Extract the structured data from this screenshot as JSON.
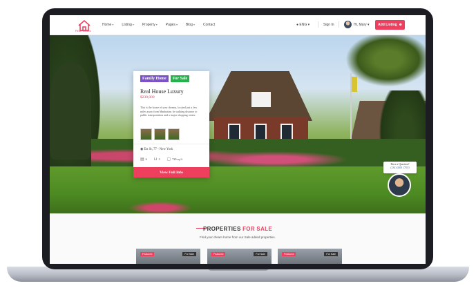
{
  "logo": {
    "text": "Find Houses"
  },
  "nav": {
    "items": [
      "Home",
      "Listing",
      "Property",
      "Pages",
      "Blog",
      "Contact"
    ],
    "language": "ENG",
    "signin": "Sign In",
    "user": "Hi, Mary",
    "add_listing": "Add Listing"
  },
  "card": {
    "badge_type": "Family Home",
    "badge_status": "For Sale",
    "title": "Real House Luxury",
    "price": "$230,000",
    "description": "This is the house of your dreams, located just a few miles away from Manhattan. In walking distance to public transportation and a major shopping center.",
    "address": "Est St, 77 - New York",
    "beds": "6",
    "baths": "3",
    "area": "720 sq ft",
    "button": "View Full Info"
  },
  "question": {
    "title": "Have a Question?",
    "phone": "(234) 0200 17813"
  },
  "section": {
    "title_a": "PROPERTIES",
    "title_b": "FOR SALE",
    "subtitle": "Find your dream home from our Sale added properties."
  },
  "property_cards": [
    {
      "badge": "Featured",
      "status": "For Sale"
    },
    {
      "badge": "Featured",
      "status": "For Sale"
    },
    {
      "badge": "Featured",
      "status": "For Sale"
    }
  ],
  "colors": {
    "accent": "#ef3f5f",
    "family_badge": "#7b52c7",
    "sale_badge": "#24b24b"
  }
}
